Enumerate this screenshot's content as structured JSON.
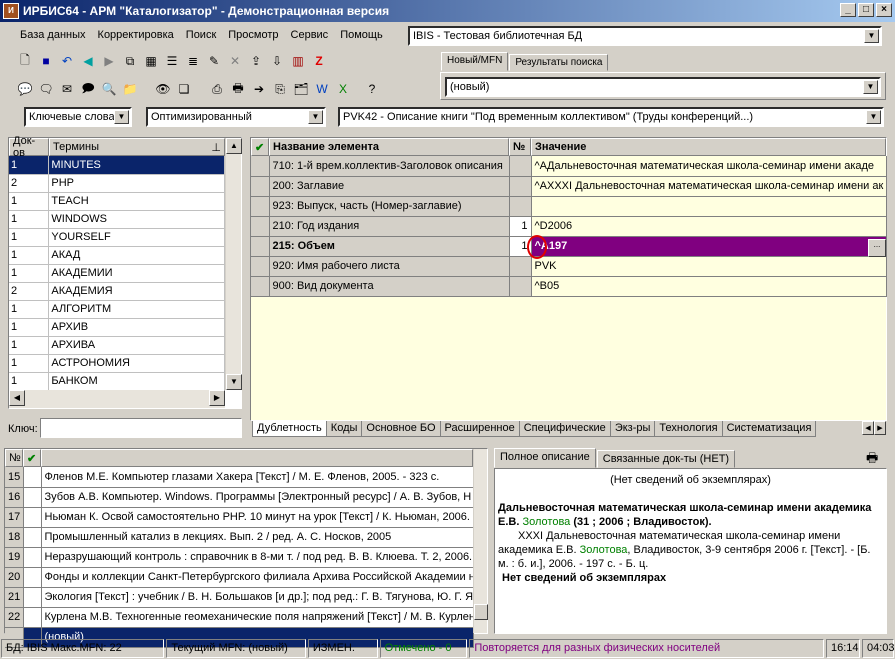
{
  "window": {
    "title": "ИРБИС64 - АРМ \"Каталогизатор\" - Демонстрационная версия",
    "app_icon": "irbis-app-icon"
  },
  "menu": [
    "База данных",
    "Корректировка",
    "Поиск",
    "Просмотр",
    "Сервис",
    "Помощь"
  ],
  "db_select": {
    "value": "IBIS - Тестовая библиотечная БД"
  },
  "right_tabs": [
    "Новый/MFN",
    "Результаты поиска"
  ],
  "new_mfn_combo": {
    "value": "(новый)"
  },
  "filters": {
    "dictionary": "Ключевые слова",
    "mode": "Оптимизированный",
    "worksheet": "PVK42 - Описание книги \"Под временным коллективом\" (Труды конференций...)"
  },
  "terms": {
    "headers": [
      "Док-ов",
      "Термины"
    ],
    "rows": [
      {
        "count": "1",
        "term": "MINUTES"
      },
      {
        "count": "2",
        "term": "PHP"
      },
      {
        "count": "1",
        "term": "TEACH"
      },
      {
        "count": "1",
        "term": "WINDOWS"
      },
      {
        "count": "1",
        "term": "YOURSELF"
      },
      {
        "count": "1",
        "term": "АКАД"
      },
      {
        "count": "1",
        "term": "АКАДЕМИИ"
      },
      {
        "count": "2",
        "term": "АКАДЕМИЯ"
      },
      {
        "count": "1",
        "term": "АЛГОРИТМ"
      },
      {
        "count": "1",
        "term": "АРХИВ"
      },
      {
        "count": "1",
        "term": "АРХИВА"
      },
      {
        "count": "1",
        "term": "АСТРОНОМИЯ"
      },
      {
        "count": "1",
        "term": "БАНКОМ"
      }
    ],
    "key_label": "Ключ:"
  },
  "fields": {
    "headers": [
      "Название элемента",
      "№",
      "Значение"
    ],
    "rows": [
      {
        "name": "710: 1-й врем.коллектив-Заголовок описания",
        "num": "",
        "value": "^AДальневосточная математическая школа-семинар имени акаде"
      },
      {
        "name": "200: Заглавие",
        "num": "",
        "value": "^AXXXI Дальневосточная математическая школа-семинар имени ак"
      },
      {
        "name": "923: Выпуск, часть (Номер-заглавие)",
        "num": "",
        "value": ""
      },
      {
        "name": "210: Год издания",
        "num": "1",
        "value": "^D2006"
      },
      {
        "name": "215: Объем",
        "num": "1",
        "value": "^A197",
        "selected": true
      },
      {
        "name": "920: Имя рабочего листа",
        "num": "",
        "value": "PVK"
      },
      {
        "name": "900: Вид документа",
        "num": "",
        "value": "^B05"
      }
    ],
    "ellipsis": "...",
    "bottom_tabs": [
      "Дублетность",
      "Коды",
      "Основное БО",
      "Расширенное",
      "Специфические",
      "Экз-ры",
      "Технология",
      "Систематизация"
    ]
  },
  "records": {
    "headers": [
      "№"
    ],
    "rows": [
      {
        "n": "15",
        "text": "Фленов М.Е. Компьютер глазами Хакера [Текст] / М. Е. Фленов, 2005. - 323 с."
      },
      {
        "n": "16",
        "text": "Зубов А.В. Компьютер. Windows. Программы [Электронный ресурс] / А. В. Зубов, Н"
      },
      {
        "n": "17",
        "text": "Ньюман К. Освой самостоятельно PHP. 10 минут на урок [Текст] / К. Ньюман, 2006."
      },
      {
        "n": "18",
        "text": "Промышленный катализ в лекциях. Вып. 2 / ред. А. С. Носков, 2005"
      },
      {
        "n": "19",
        "text": "Неразрушающий контроль : справочник в 8-ми т. / под ред. В. В. Клюева. Т. 2, 2006."
      },
      {
        "n": "20",
        "text": "Фонды и коллекции Санкт-Петербургского филиала Архива Российской Академии н"
      },
      {
        "n": "21",
        "text": "Экология [Текст] : учебник / В. Н. Большаков [и др.]; под ред.: Г. В. Тягунова, Ю. Г. Я"
      },
      {
        "n": "22",
        "text": "Курлена М.В. Техногенные геомеханические поля напряжений [Текст] / М. В. Курлен"
      },
      {
        "n": "",
        "text": "(новый)",
        "selected": true
      }
    ]
  },
  "desc": {
    "tabs": [
      "Полное описание",
      "Связанные док-ты (НЕТ)"
    ],
    "no_copies": "(Нет сведений об экземплярах)",
    "bold_line1": "Дальневосточная математическая школа-семинар имени академика Е.В.",
    "green_name": "Золотова",
    "bold_line1_tail": "(31 ; 2006 ; Владивосток).",
    "body_1": "XXXI Дальневосточная математическая школа-семинар имени академика Е.В.",
    "body_2": ", Владивосток, 3-9 сентября 2006 г. [Текст]. - [Б. м. : б. и.], 2006. - 197 с. - Б. ц.",
    "no_copies_bold": "Нет сведений об экземплярах"
  },
  "status": {
    "db": "БД: IBIS Макс.MFN: 22",
    "current": "Текущий MFN: (новый)",
    "changed": "ИЗМЕН.",
    "marked": "Отмечено - 0",
    "repeats": "Повторяется для разных физических носителей",
    "time1": "16:14",
    "time2": "04:03"
  },
  "colors": {
    "selected_row": "#0a246a",
    "field_selected": "#800080",
    "field_bg": "#ffffe0",
    "marked_text": "#008000",
    "repeats_text": "#800080",
    "check_green": "#008000"
  }
}
